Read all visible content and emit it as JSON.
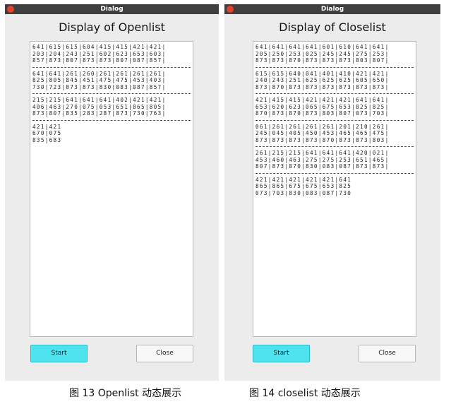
{
  "openlist_dialog": {
    "window_title": "Dialog",
    "heading": "Display of Openlist",
    "blocks": [
      [
        "641|615|615|604|415|415|421|421|",
        "203|204|243|251|602|623|653|603|",
        "857|873|807|873|873|807|087|857|"
      ],
      [
        "641|641|261|260|261|261|261|261|",
        "825|805|845|451|475|475|453|403|",
        "730|723|073|873|830|083|087|857|"
      ],
      [
        "215|215|641|641|641|402|421|421|",
        "406|463|270|075|053|651|865|805|",
        "873|807|835|283|287|873|730|763|"
      ],
      [
        "421|421",
        "670|075",
        "835|683"
      ]
    ],
    "start_label": "Start",
    "close_label": "Close"
  },
  "closelist_dialog": {
    "window_title": "Dialog",
    "heading": "Display of Closelist",
    "blocks": [
      [
        "641|641|641|641|601|610|641|641|",
        "205|250|253|025|245|245|275|253|",
        "873|873|870|873|873|873|803|807|"
      ],
      [
        "615|615|640|041|401|410|421|421|",
        "240|243|251|625|625|625|605|650|",
        "873|870|873|873|873|873|873|873|"
      ],
      [
        "421|415|415|421|421|421|641|641|",
        "653|620|623|065|675|653|825|825|",
        "870|873|870|873|803|807|073|703|"
      ],
      [
        "061|261|261|261|261|201|210|261|",
        "245|045|405|450|453|465|465|475|",
        "873|873|873|873|870|873|873|803|"
      ],
      [
        "261|215|215|641|641|641|420|021|",
        "453|460|463|275|275|253|651|465|",
        "807|873|870|830|083|087|873|873|"
      ],
      [
        "421|421|421|421|421|641",
        "865|865|675|675|653|825",
        "073|703|830|083|087|730"
      ]
    ],
    "start_label": "Start",
    "close_label": "Close"
  },
  "captions": {
    "left": "图  13 Openlist 动态展示",
    "right": "图  14 closelist 动态展示"
  }
}
